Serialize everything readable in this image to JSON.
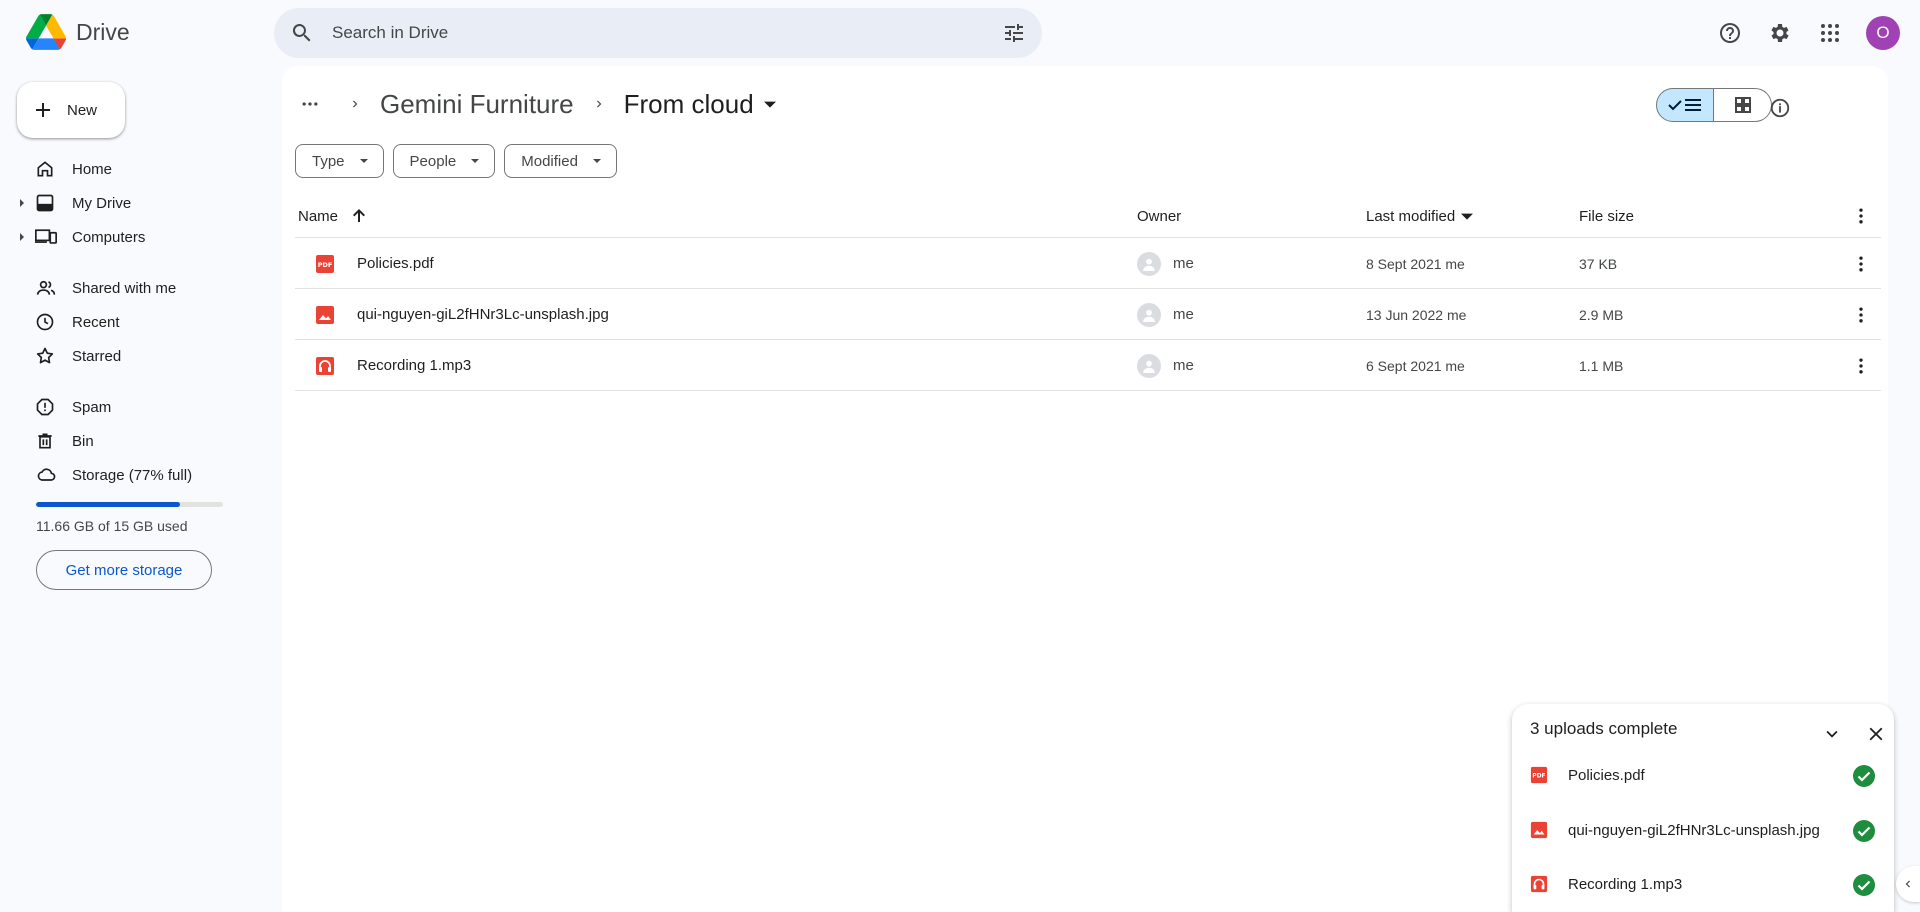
{
  "app": {
    "name": "Drive"
  },
  "search": {
    "placeholder": "Search in Drive"
  },
  "header": {
    "avatar_initial": "O"
  },
  "sidebar": {
    "new_label": "New",
    "items": [
      {
        "label": "Home"
      },
      {
        "label": "My Drive"
      },
      {
        "label": "Computers"
      },
      {
        "label": "Shared with me"
      },
      {
        "label": "Recent"
      },
      {
        "label": "Starred"
      },
      {
        "label": "Spam"
      },
      {
        "label": "Bin"
      },
      {
        "label": "Storage (77% full)"
      }
    ],
    "storage": {
      "percent": 77,
      "used_text": "11.66 GB of 15 GB used",
      "button_label": "Get more storage"
    }
  },
  "breadcrumb": {
    "parent": "Gemini Furniture",
    "current": "From cloud"
  },
  "filters": [
    {
      "label": "Type"
    },
    {
      "label": "People"
    },
    {
      "label": "Modified"
    }
  ],
  "table": {
    "columns": {
      "name": "Name",
      "owner": "Owner",
      "modified": "Last modified",
      "size": "File size"
    },
    "rows": [
      {
        "name": "Policies.pdf",
        "type": "pdf",
        "owner": "me",
        "modified": "8 Sept 2021 me",
        "size": "37 KB"
      },
      {
        "name": "qui-nguyen-giL2fHNr3Lc-unsplash.jpg",
        "type": "image",
        "owner": "me",
        "modified": "13 Jun 2022 me",
        "size": "2.9 MB"
      },
      {
        "name": "Recording 1.mp3",
        "type": "audio",
        "owner": "me",
        "modified": "6 Sept 2021 me",
        "size": "1.1 MB"
      }
    ]
  },
  "uploads": {
    "title": "3 uploads complete",
    "items": [
      {
        "name": "Policies.pdf",
        "type": "pdf"
      },
      {
        "name": "qui-nguyen-giL2fHNr3Lc-unsplash.jpg",
        "type": "image"
      },
      {
        "name": "Recording 1.mp3",
        "type": "audio"
      }
    ]
  },
  "colors": {
    "accent": "#0b57d0",
    "file_red": "#ea4335",
    "success": "#1e8e3e",
    "avatar": "#a142b4",
    "view_selected": "#c2e7ff"
  }
}
